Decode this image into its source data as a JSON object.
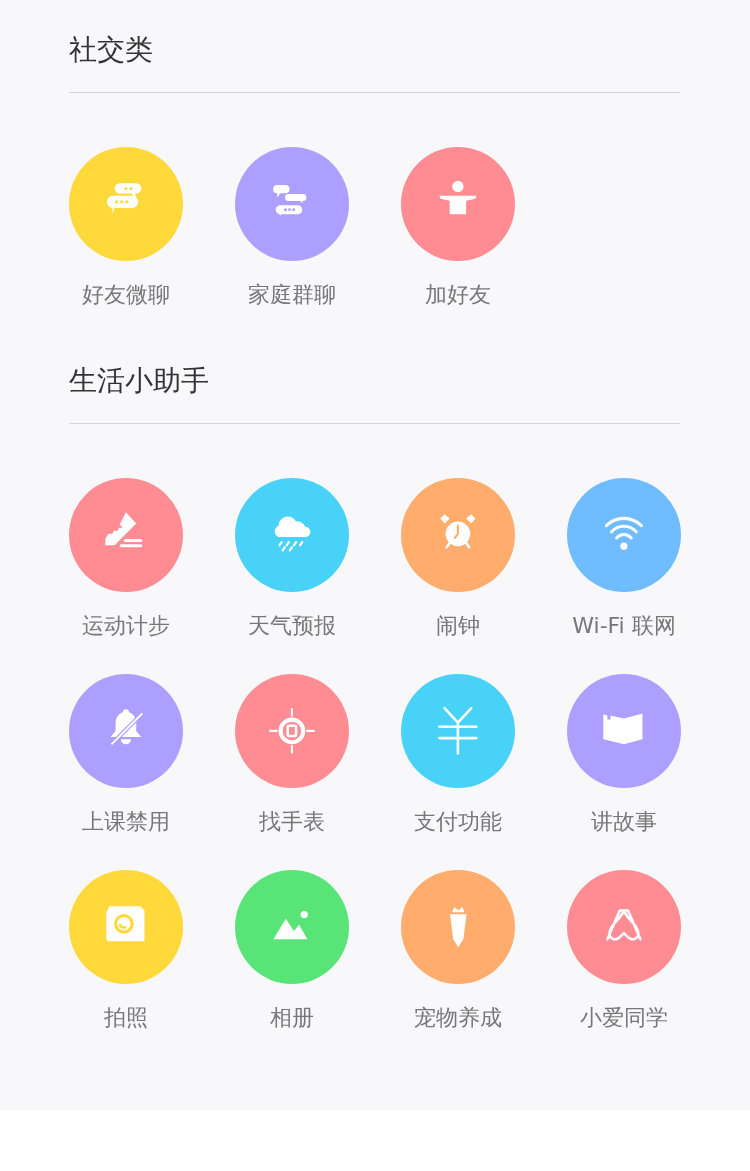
{
  "sections": [
    {
      "title": "社交类",
      "items": [
        {
          "label": "好友微聊",
          "color": "#ffd83a"
        },
        {
          "label": "家庭群聊",
          "color": "#ad9fff"
        },
        {
          "label": "加好友",
          "color": "#ff8b93"
        }
      ]
    },
    {
      "title": "生活小助手",
      "items": [
        {
          "label": "运动计步",
          "color": "#ff8b93"
        },
        {
          "label": "天气预报",
          "color": "#48d2f7"
        },
        {
          "label": "闹钟",
          "color": "#ffac6c"
        },
        {
          "label": "Wi-Fi 联网",
          "color": "#6fbcff"
        },
        {
          "label": "上课禁用",
          "color": "#ad9fff"
        },
        {
          "label": "找手表",
          "color": "#ff8b93"
        },
        {
          "label": "支付功能",
          "color": "#48d2f7"
        },
        {
          "label": "讲故事",
          "color": "#ad9fff"
        },
        {
          "label": "拍照",
          "color": "#ffd83a"
        },
        {
          "label": "相册",
          "color": "#58e477"
        },
        {
          "label": "宠物养成",
          "color": "#ffac6c"
        },
        {
          "label": "小爱同学",
          "color": "#ff8b93"
        }
      ]
    }
  ]
}
